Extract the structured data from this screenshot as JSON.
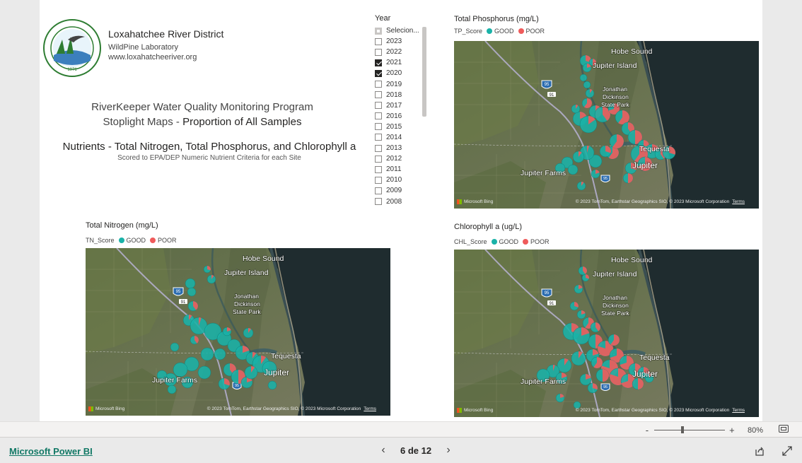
{
  "header": {
    "org_name": "Loxahatchee River District",
    "org_lab": "WildPine Laboratory",
    "org_url": "www.loxahatcheeriver.org",
    "logo_year": "1971",
    "program_line1": "RiverKeeper Water Quality Monitoring Program",
    "program_line2a": "Stoplight Maps - ",
    "program_line2b": "Proportion of All Samples",
    "nutrients_title": "Nutrients - Total Nitrogen, Total Phosphorus, and Chlorophyll a",
    "nutrients_sub": "Scored to EPA/DEP Numeric Nutrient Criteria for each Site"
  },
  "slicer": {
    "title": "Year",
    "items": [
      {
        "label": "Selecion...",
        "state": "partial"
      },
      {
        "label": "2023",
        "state": "unchecked"
      },
      {
        "label": "2022",
        "state": "unchecked"
      },
      {
        "label": "2021",
        "state": "checked"
      },
      {
        "label": "2020",
        "state": "checked"
      },
      {
        "label": "2019",
        "state": "unchecked"
      },
      {
        "label": "2018",
        "state": "unchecked"
      },
      {
        "label": "2017",
        "state": "unchecked"
      },
      {
        "label": "2016",
        "state": "unchecked"
      },
      {
        "label": "2015",
        "state": "unchecked"
      },
      {
        "label": "2014",
        "state": "unchecked"
      },
      {
        "label": "2013",
        "state": "unchecked"
      },
      {
        "label": "2012",
        "state": "unchecked"
      },
      {
        "label": "2011",
        "state": "unchecked"
      },
      {
        "label": "2010",
        "state": "unchecked"
      },
      {
        "label": "2009",
        "state": "unchecked"
      },
      {
        "label": "2008",
        "state": "unchecked"
      }
    ]
  },
  "maps": {
    "tp": {
      "title": "Total Phosphorus (mg/L)",
      "legend_field": "TP_Score",
      "good": "GOOD",
      "poor": "POOR"
    },
    "tn": {
      "title": "Total Nitrogen (mg/L)",
      "legend_field": "TN_Score",
      "good": "GOOD",
      "poor": "POOR"
    },
    "chl": {
      "title": "Chlorophyll a (ug/L)",
      "legend_field": "CHL_Score",
      "good": "GOOD",
      "poor": "POOR"
    },
    "labels": {
      "hobe": "Hobe Sound",
      "jupiter_island": "Jupiter Island",
      "park1": "Jonathan",
      "park2": "Dickinson",
      "park3": "State Park",
      "tequesta": "Tequesta",
      "jupiter": "Jupiter",
      "jupiter_farms": "Jupiter Farms",
      "i95": "95",
      "r91": "91"
    },
    "attribution": "© 2023 TomTom, Earthstar Geographics SIO, © 2023 Microsoft Corporation",
    "terms": "Terms",
    "bing": "Microsoft Bing"
  },
  "colors": {
    "good": "#1ab2a8",
    "poor": "#ef5b5b"
  },
  "status": {
    "zoom_minus": "-",
    "zoom_plus": "+",
    "zoom_value": "80%"
  },
  "footer": {
    "powerbi": "Microsoft Power BI",
    "page_indicator": "6 de 12",
    "prev": "‹",
    "next": "›"
  }
}
